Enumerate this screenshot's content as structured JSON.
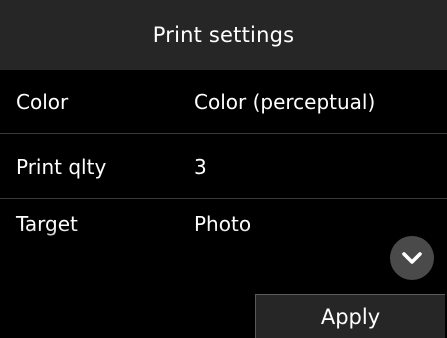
{
  "header": {
    "title": "Print settings"
  },
  "settings": [
    {
      "label": "Color",
      "value": "Color (perceptual)"
    },
    {
      "label": "Print qlty",
      "value": "3"
    },
    {
      "label": "Target",
      "value": "Photo"
    }
  ],
  "scroll_button": {
    "icon": "chevron-down-icon"
  },
  "footer": {
    "apply_label": "Apply"
  },
  "colors": {
    "background": "#000000",
    "header_bg": "#262626",
    "divider": "#3a3a3a",
    "scroll_button_bg": "#4a4a4a",
    "text": "#ffffff"
  }
}
